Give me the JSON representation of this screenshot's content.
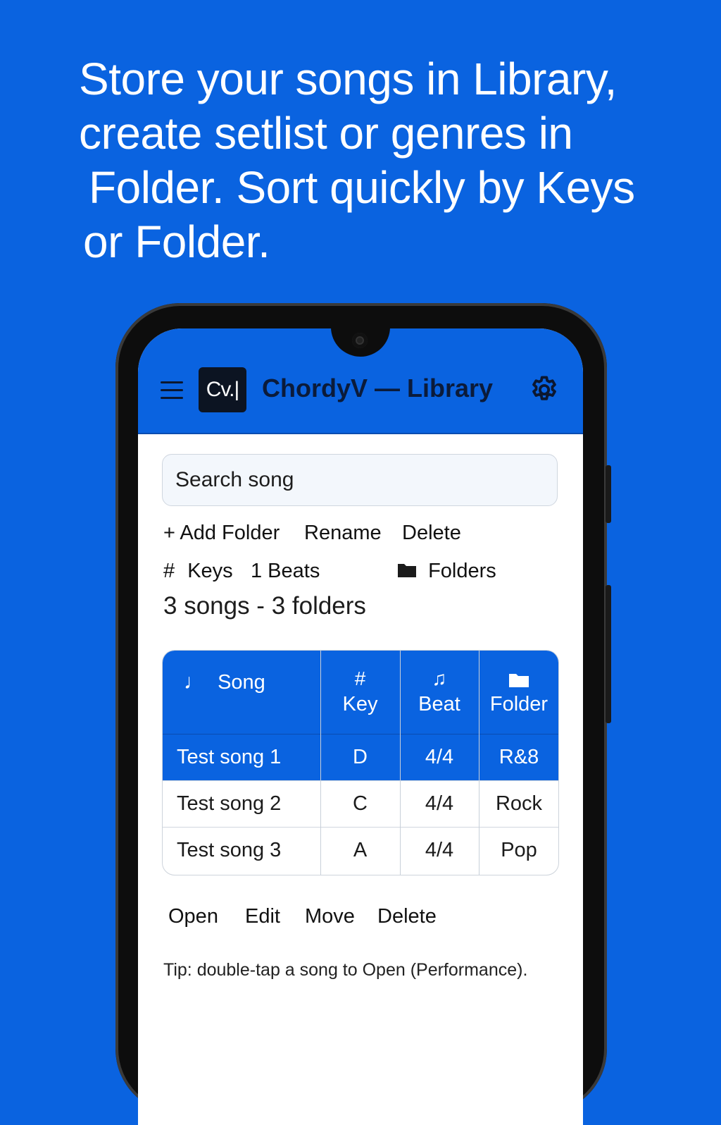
{
  "headline": {
    "line1": "Store your songs in Library,",
    "line2": "create setlist or genres in",
    "line3": "Folder. Sort quickly by Keys",
    "line4": "or Folder."
  },
  "appbar": {
    "menu_icon": "hamburger-menu-icon",
    "logo_text": "Cv.|",
    "title": "ChordyV — Library",
    "settings_icon": "gear-icon"
  },
  "search": {
    "placeholder": "Search song"
  },
  "folder_actions": {
    "add": "+ Add Folder",
    "rename": "Rename",
    "delete": "Delete"
  },
  "sort_options": {
    "keys_icon": "#",
    "keys": "Keys",
    "beats": "1 Beats",
    "folders_icon": "folder-icon",
    "folders": "Folders"
  },
  "summary": "3 songs - 3 folders",
  "table": {
    "headers": [
      {
        "icon": "music-note-icon",
        "glyph": "♩",
        "label": "Song"
      },
      {
        "icon": "hash-icon",
        "glyph": "#",
        "label": "Key"
      },
      {
        "icon": "beamed-notes-icon",
        "glyph": "♫",
        "label": "Beat"
      },
      {
        "icon": "folder-icon",
        "glyph": "",
        "label": "Folder"
      }
    ],
    "rows": [
      {
        "song": "Test song 1",
        "key": "D",
        "beat": "4/4",
        "folder": "R&8",
        "selected": true
      },
      {
        "song": "Test song 2",
        "key": "C",
        "beat": "4/4",
        "folder": "Rock",
        "selected": false
      },
      {
        "song": "Test song 3",
        "key": "A",
        "beat": "4/4",
        "folder": "Pop",
        "selected": false
      }
    ]
  },
  "song_actions": {
    "open": "Open",
    "edit": "Edit",
    "move": "Move",
    "delete": "Delete"
  },
  "tip": "Tip: double-tap a song to Open (Performance).",
  "colors": {
    "brand_blue": "#0a63e0",
    "appbar_text": "#0b1b3a",
    "logo_bg": "#0c1422"
  }
}
